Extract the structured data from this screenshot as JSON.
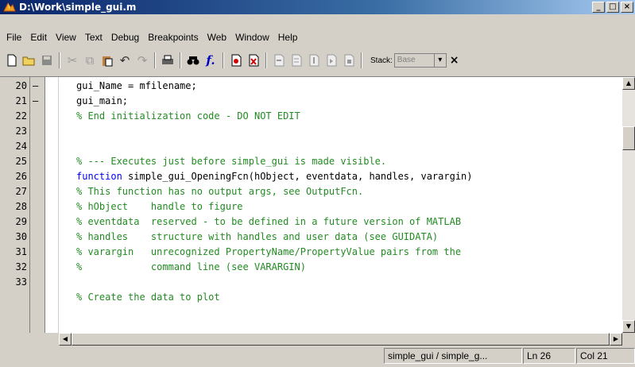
{
  "window": {
    "title": "D:\\Work\\simple_gui.m",
    "minimize": "_",
    "restore": "□",
    "close": "×"
  },
  "menu": [
    "File",
    "Edit",
    "View",
    "Text",
    "Debug",
    "Breakpoints",
    "Web",
    "Window",
    "Help"
  ],
  "toolbar": {
    "stack_label": "Stack:",
    "stack_value": "Base",
    "stack_arrow": "▾",
    "close": "×"
  },
  "editor": {
    "lines": [
      {
        "num": "20",
        "dash": "–",
        "text": "gui_Name = mfilename;",
        "color": "black"
      },
      {
        "num": "21",
        "dash": "–",
        "text": "gui_main;",
        "color": "black"
      },
      {
        "num": "22",
        "dash": "",
        "text": "% End initialization code - DO NOT EDIT",
        "color": "green"
      },
      {
        "num": "23",
        "dash": "",
        "text": "",
        "color": "black"
      },
      {
        "num": "24",
        "dash": "",
        "text": "",
        "color": "black"
      },
      {
        "num": "25",
        "dash": "",
        "text": "% --- Executes just before simple_gui is made visible.",
        "color": "green"
      },
      {
        "num": "26",
        "dash": "",
        "text": "function simple_gui_OpeningFcn(hObject, eventdata, handles, varargin)",
        "color": "mixed"
      },
      {
        "num": "27",
        "dash": "",
        "text": "% This function has no output args, see OutputFcn.",
        "color": "green"
      },
      {
        "num": "28",
        "dash": "",
        "text": "% hObject    handle to figure",
        "color": "green"
      },
      {
        "num": "29",
        "dash": "",
        "text": "% eventdata  reserved - to be defined in a future version of MATLAB",
        "color": "green"
      },
      {
        "num": "30",
        "dash": "",
        "text": "% handles    structure with handles and user data (see GUIDATA)",
        "color": "green"
      },
      {
        "num": "31",
        "dash": "",
        "text": "% varargin   unrecognized PropertyName/PropertyValue pairs from the",
        "color": "green"
      },
      {
        "num": "32",
        "dash": "",
        "text": "%            command line (see VARARGIN)",
        "color": "green"
      },
      {
        "num": "33",
        "dash": "",
        "text": "",
        "color": "black"
      },
      {
        "num": "",
        "dash": "",
        "text": "% Create the data to plot",
        "color": "green"
      }
    ],
    "function_keyword": "function",
    "function_rest": " simple_gui_OpeningFcn(hObject, eventdata, handles, varargin)"
  },
  "status": {
    "file": "simple_gui / simple_g...",
    "line": "Ln  26",
    "col": "Col 21"
  },
  "colors": {
    "comment": "#228b22",
    "keyword": "#0000ff",
    "titlebar": "#0a246a"
  }
}
